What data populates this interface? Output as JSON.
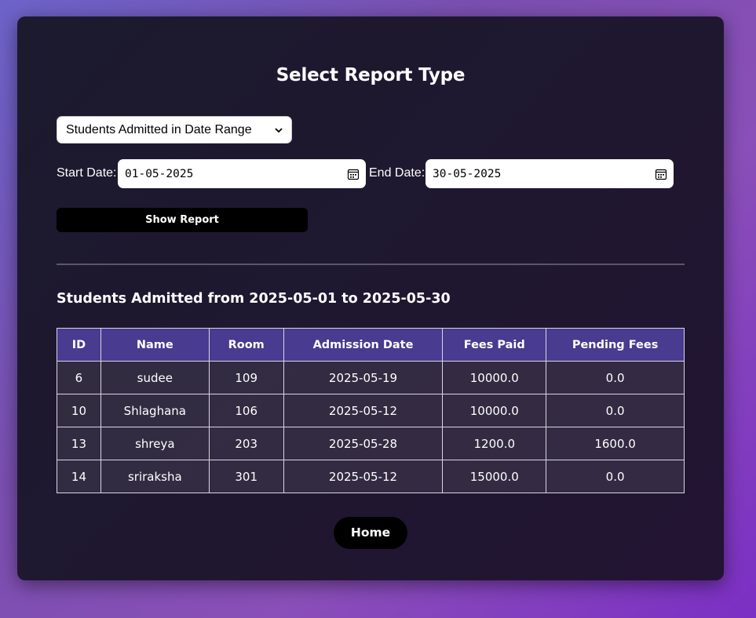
{
  "form": {
    "title": "Select Report Type",
    "report_type_selected": "Students Admitted in Date Range",
    "start_label": "Start Date:",
    "start_value": "01-05-2025",
    "end_label": "End Date:",
    "end_value": "30-05-2025",
    "show_button": "Show Report"
  },
  "report": {
    "subtitle": "Students Admitted from 2025-05-01 to 2025-05-30",
    "columns": [
      "ID",
      "Name",
      "Room",
      "Admission Date",
      "Fees Paid",
      "Pending Fees"
    ],
    "rows": [
      [
        "6",
        "sudee",
        "109",
        "2025-05-19",
        "10000.0",
        "0.0"
      ],
      [
        "10",
        "Shlaghana",
        "106",
        "2025-05-12",
        "10000.0",
        "0.0"
      ],
      [
        "13",
        "shreya",
        "203",
        "2025-05-28",
        "1200.0",
        "1600.0"
      ],
      [
        "14",
        "sriraksha",
        "301",
        "2025-05-12",
        "15000.0",
        "0.0"
      ]
    ]
  },
  "nav": {
    "home_button": "Home"
  },
  "icons": {
    "select_arrow": "chevron-down-icon",
    "date_picker": "calendar-icon"
  },
  "colors": {
    "table_header": "#483b90",
    "button": "#000000",
    "card": "#1c1a2e"
  }
}
